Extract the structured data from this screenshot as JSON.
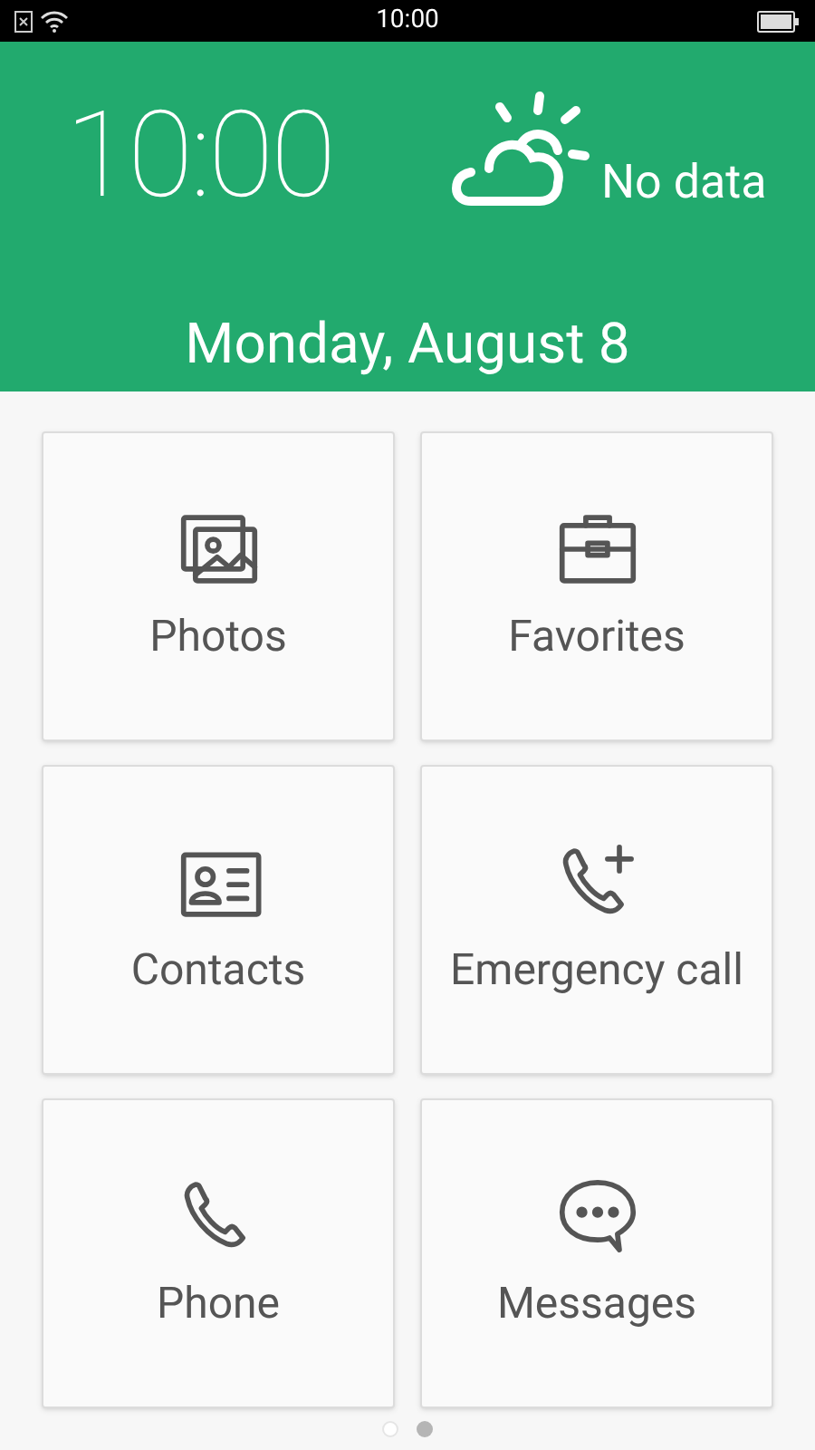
{
  "status_bar": {
    "time": "10:00"
  },
  "header": {
    "clock": "10:00",
    "weather": "No data",
    "date": "Monday, August 8"
  },
  "tiles": [
    {
      "label": "Photos"
    },
    {
      "label": "Favorites"
    },
    {
      "label": "Contacts"
    },
    {
      "label": "Emergency call"
    },
    {
      "label": "Phone"
    },
    {
      "label": "Messages"
    }
  ],
  "page_dots": [
    {
      "selected": false
    },
    {
      "selected": true
    }
  ]
}
